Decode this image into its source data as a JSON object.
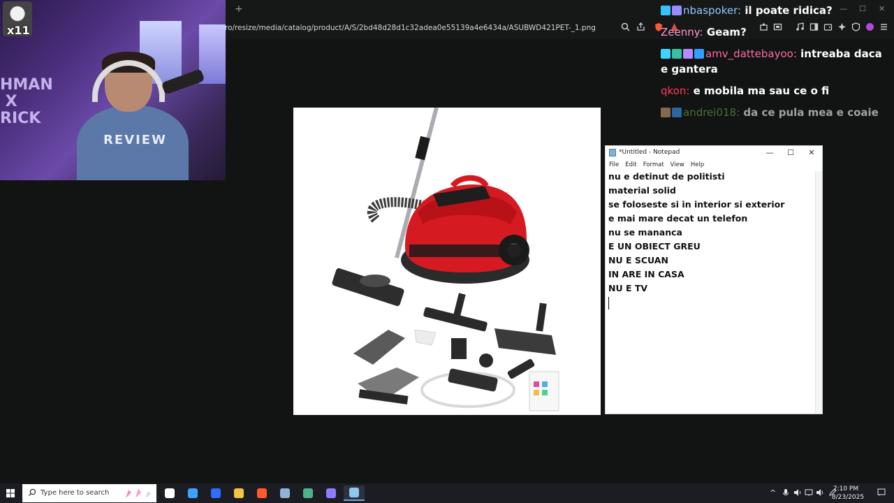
{
  "browser": {
    "new_tab": "+",
    "url": "ro/resize/media/catalog/product/A/S/2bd48d28d1c32adea0e55139a4e6434a/ASUBWD421PET-_1.png",
    "icons": [
      "zoom-icon",
      "share-icon",
      "brave-shield-icon",
      "extensions-icon",
      "screenshot-icon",
      "music-icon",
      "sidebar-icon",
      "wallet-icon",
      "leo-icon",
      "vpn-icon",
      "menu-icon"
    ]
  },
  "webcam": {
    "channel_tag": "x11",
    "banner_text": "HMAN\nX\nRICK",
    "shirt_text": "REVIEW"
  },
  "notepad": {
    "title": "*Untitled - Notepad",
    "minimize": "—",
    "maximize": "☐",
    "close": "✕",
    "menu": [
      "File",
      "Edit",
      "Format",
      "View",
      "Help"
    ],
    "lines": [
      "nu e detinut de politisti",
      "material solid",
      "se foloseste si in interior si exterior",
      "e mai mare decat un telefon",
      "nu se mananca",
      "E UN OBIECT GREU",
      "NU E SCUAN",
      "IN ARE IN CASA",
      "NU E TV"
    ]
  },
  "chat": [
    {
      "user": "nbaspoker",
      "text": "il poate ridica?",
      "color": "#8ec9ff",
      "badges": [
        "#33c4ff",
        "#9b8cff"
      ],
      "faded": false
    },
    {
      "user": "Zeenny",
      "text": "Geam?",
      "color": "#ff9bd0",
      "badges": [],
      "faded": false
    },
    {
      "user": "amv_dattebayoo",
      "text": "intreaba daca e gantera",
      "color": "#ff6aa6",
      "badges": [
        "#3bd6ff",
        "#38c0a0",
        "#b38cff",
        "#2fa0ff"
      ],
      "faded": false
    },
    {
      "user": "qkon",
      "text": "e mobila ma sau ce o fi",
      "color": "#ff3b5c",
      "badges": [],
      "faded": false
    },
    {
      "user": "andrei018",
      "text": "da ce pula mea e coaie",
      "color": "#6ab04c",
      "badges": [
        "#d4a373",
        "#3aa0ff"
      ],
      "faded": true
    }
  ],
  "taskbar": {
    "search_placeholder": "Type here to search",
    "apps": [
      {
        "name": "task-view-app",
        "color": "#ffffff",
        "active": false
      },
      {
        "name": "copilot-app",
        "color": "#3fa1ff",
        "active": false
      },
      {
        "name": "copilot-alt-app",
        "color": "#2f6dff",
        "active": false
      },
      {
        "name": "file-explorer-app",
        "color": "#f4c542",
        "active": false
      },
      {
        "name": "brave-app",
        "color": "#ff5a2f",
        "active": false
      },
      {
        "name": "steam-app",
        "color": "#8fb4d9",
        "active": false
      },
      {
        "name": "terminal-app",
        "color": "#4fb38a",
        "active": false
      },
      {
        "name": "discord-app",
        "color": "#8d7cff",
        "active": false
      },
      {
        "name": "notepad-app",
        "color": "#8fc9ee",
        "active": true
      }
    ],
    "tray_chevron": "^",
    "time": "7:10 PM",
    "date": "8/23/2025"
  }
}
